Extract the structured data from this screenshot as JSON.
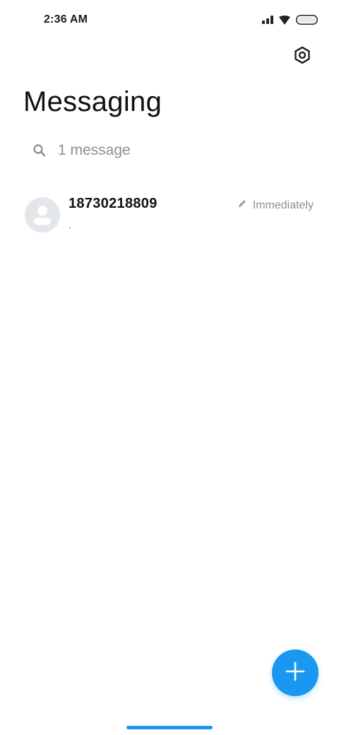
{
  "status_bar": {
    "time": "2:36 AM",
    "icons": [
      "signal-icon",
      "wifi-icon",
      "battery-icon"
    ]
  },
  "header": {
    "settings_icon": "settings-hexagon-icon"
  },
  "page": {
    "title": "Messaging"
  },
  "search": {
    "placeholder": "1 message",
    "icon": "search-icon"
  },
  "conversations": [
    {
      "name": "18730218809",
      "preview": ".",
      "time": "Immediately",
      "draft_icon": "pencil-icon",
      "avatar_icon": "person-icon"
    }
  ],
  "fab": {
    "icon": "plus-icon"
  },
  "colors": {
    "accent": "#1a97f0",
    "text_primary": "#111111",
    "text_secondary": "#8e8e8e",
    "avatar_bg": "#e3e6ea"
  }
}
